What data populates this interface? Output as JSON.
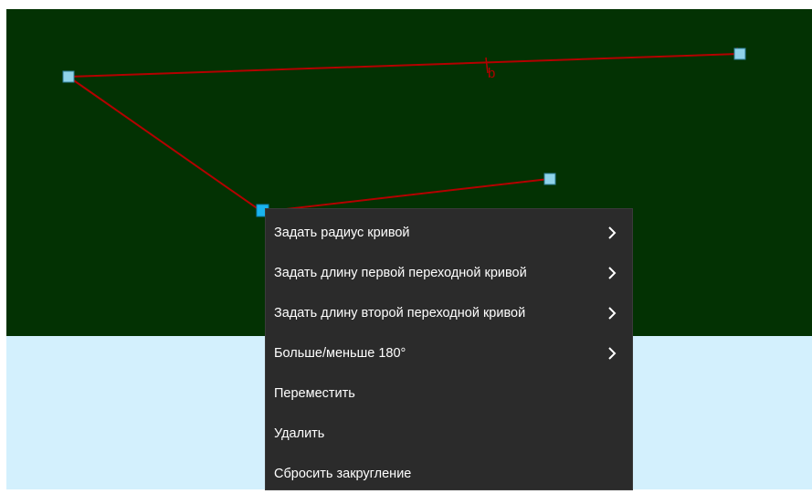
{
  "map": {
    "colors": {
      "background_top": "#033203",
      "background_bottom": "#d3f0fd",
      "polyline": "#b40000",
      "vertex": "#8fd3ea",
      "vertex_selected": "#19b4ef"
    },
    "segment_label": "b",
    "vertex_icon": "square-handle-icon"
  },
  "context_menu": {
    "items": [
      {
        "label": "Задать радиус кривой",
        "has_submenu": true
      },
      {
        "label": "Задать длину первой переходной кривой",
        "has_submenu": true
      },
      {
        "label": "Задать длину второй переходной кривой",
        "has_submenu": true
      },
      {
        "label": "Больше/меньше 180°",
        "has_submenu": true
      },
      {
        "label": "Переместить",
        "has_submenu": false
      },
      {
        "label": "Удалить",
        "has_submenu": false
      },
      {
        "label": "Сбросить закругление",
        "has_submenu": false
      }
    ],
    "submenu_icon": "chevron-right-icon"
  }
}
